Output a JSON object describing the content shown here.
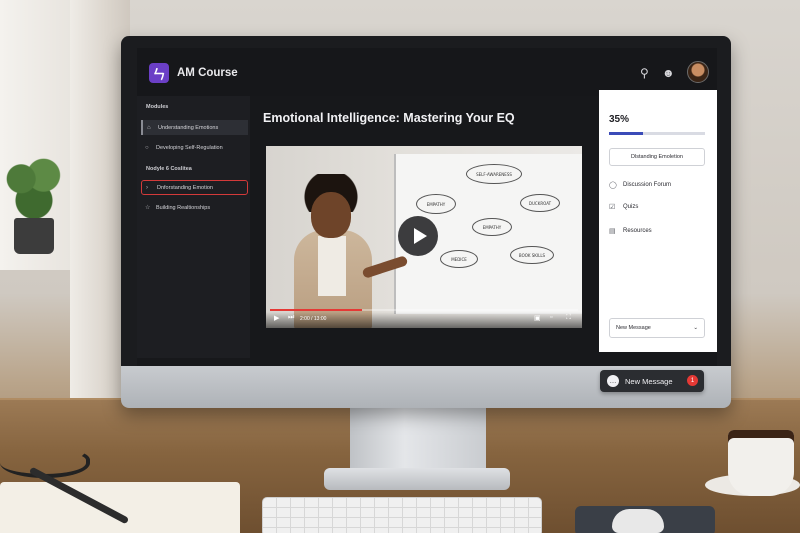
{
  "app": {
    "logo_glyph": "ㄣ",
    "title": "AM Course",
    "icons": [
      "search-icon",
      "user-icon"
    ],
    "accent": "#6b3fc6"
  },
  "sidebar": {
    "heading_modules": "Modules",
    "heading_section": "Nodyle 6 Coslitea",
    "items": [
      {
        "label": "Understanding Emotions",
        "icon": "home-icon",
        "state": "active"
      },
      {
        "label": "Developing Self-Regulation",
        "icon": "circle-icon",
        "state": "normal"
      },
      {
        "label": "Dnforstanding Emotion",
        "icon": "arrow-icon",
        "state": "highlighted"
      },
      {
        "label": "Building Realtionships",
        "icon": "star-icon",
        "state": "normal"
      }
    ]
  },
  "lesson": {
    "title": "Emotional Intelligence: Mastering Your EQ"
  },
  "video": {
    "whiteboard_nodes": [
      "SELF-AWARENESS",
      "EMPATHY",
      "EMPATHY",
      "DUCKROAT",
      "BOOK SKILLS",
      "MEDICE"
    ],
    "time_label": "2:00 / 13:00",
    "progress": 0.3,
    "progress_color": "#e53935"
  },
  "panel": {
    "progress_label": "35%",
    "progress_value": 0.35,
    "progress_color": "#3b4bb8",
    "current_chip": "Dlstanding Emoletion",
    "links": [
      {
        "label": "Discussion Forum",
        "icon": "chat-icon"
      },
      {
        "label": "Quizs",
        "icon": "check-icon"
      },
      {
        "label": "Resources",
        "icon": "file-icon"
      }
    ],
    "message_select": "New Message"
  },
  "floating": {
    "new_message_label": "New Message",
    "badge_count": "1",
    "badge_color": "#e53935"
  }
}
